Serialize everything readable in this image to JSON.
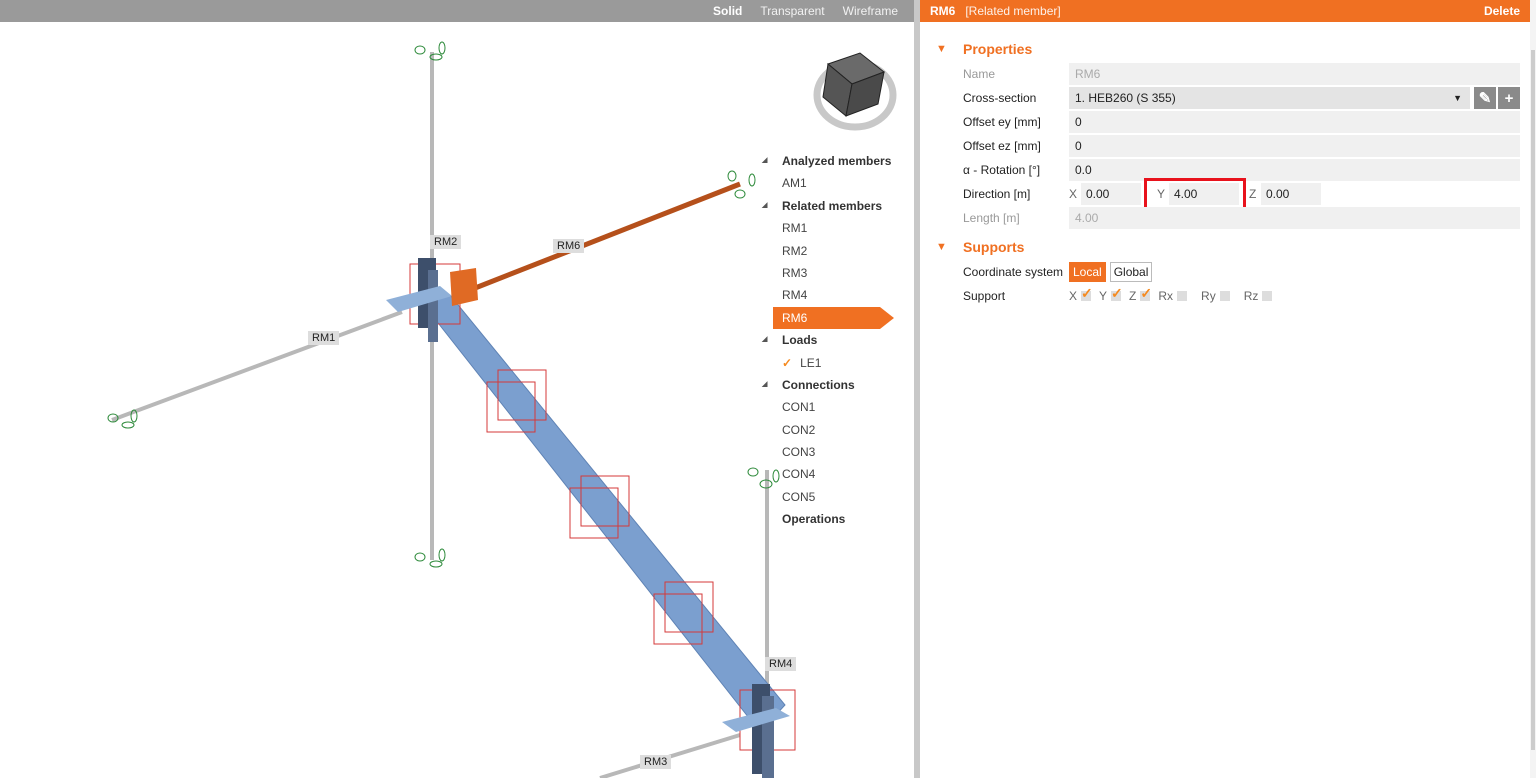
{
  "viewport": {
    "modes": [
      "Solid",
      "Transparent",
      "Wireframe"
    ],
    "active_mode": "Solid",
    "member_labels": {
      "rm1": "RM1",
      "rm2": "RM2",
      "rm3": "RM3",
      "rm4": "RM4",
      "rm6": "RM6"
    }
  },
  "tree": {
    "items": [
      {
        "label": "Analyzed members",
        "type": "header"
      },
      {
        "label": "AM1",
        "type": "item"
      },
      {
        "label": "Related members",
        "type": "header"
      },
      {
        "label": "RM1",
        "type": "item"
      },
      {
        "label": "RM2",
        "type": "item"
      },
      {
        "label": "RM3",
        "type": "item"
      },
      {
        "label": "RM4",
        "type": "item"
      },
      {
        "label": "RM6",
        "type": "selected"
      },
      {
        "label": "Loads",
        "type": "header"
      },
      {
        "label": "LE1",
        "type": "check"
      },
      {
        "label": "Connections",
        "type": "header"
      },
      {
        "label": "CON1",
        "type": "item"
      },
      {
        "label": "CON2",
        "type": "item"
      },
      {
        "label": "CON3",
        "type": "item"
      },
      {
        "label": "CON4",
        "type": "item"
      },
      {
        "label": "CON5",
        "type": "item"
      },
      {
        "label": "Operations",
        "type": "plain-bold"
      }
    ]
  },
  "panel": {
    "title": "RM6",
    "subtitle": "[Related member]",
    "delete": "Delete",
    "properties": {
      "heading": "Properties",
      "name_label": "Name",
      "name_value": "RM6",
      "cs_label": "Cross-section",
      "cs_value": "1. HEB260 (S 355)",
      "ey_label": "Offset ey [mm]",
      "ey_value": "0",
      "ez_label": "Offset ez [mm]",
      "ez_value": "0",
      "rot_label": "α - Rotation [°]",
      "rot_value": "0.0",
      "dir_label": "Direction [m]",
      "dir_x_label": "X",
      "dir_x": "0.00",
      "dir_y_label": "Y",
      "dir_y": "4.00",
      "dir_z_label": "Z",
      "dir_z": "0.00",
      "len_label": "Length [m]",
      "len_value": "4.00"
    },
    "supports": {
      "heading": "Supports",
      "coord_label": "Coordinate system",
      "local": "Local",
      "global": "Global",
      "coord_active": "Local",
      "support_label": "Support",
      "dofs": [
        {
          "label": "X",
          "checked": true
        },
        {
          "label": "Y",
          "checked": true
        },
        {
          "label": "Z",
          "checked": true
        },
        {
          "label": "Rx",
          "checked": false
        },
        {
          "label": "Ry",
          "checked": false
        },
        {
          "label": "Rz",
          "checked": false
        }
      ]
    }
  },
  "colors": {
    "accent": "#f07022",
    "highlight": "#e8121c",
    "beam": "#7b9fcf"
  }
}
